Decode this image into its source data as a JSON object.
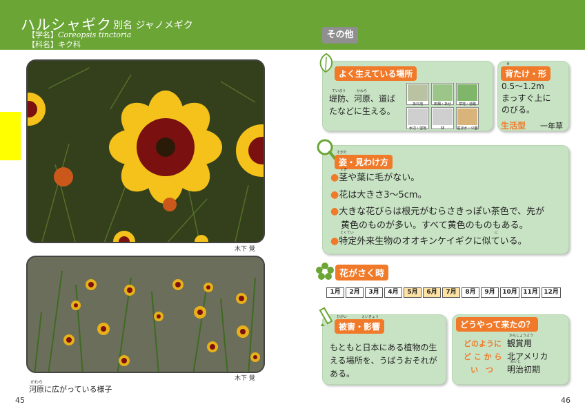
{
  "header": {
    "name": "ハルシャギク",
    "alias_label": "別名",
    "alias": "ジャノメギク",
    "scientific_label": "【学名】",
    "scientific": "Coreopsis tinctoria",
    "family_label": "【科名】",
    "family": "キク科",
    "section_tag": "その他"
  },
  "photos": {
    "credit_1": "木下 覺",
    "credit_2": "木下 覺",
    "caption_ruby": "かわら",
    "caption": "河原に広がっている様子"
  },
  "pages": {
    "left": "45",
    "right": "46"
  },
  "habitat": {
    "title": "よく生えている場所",
    "ruby_1": "ていぼう",
    "ruby_2": "かわら",
    "line_1": "堤防、河原、道ば",
    "line_2": "たなどに生える。",
    "icons": [
      {
        "name": "あれ地",
        "active": true
      },
      {
        "name": "田畑・あぜ",
        "active": true
      },
      {
        "name": "草地・道路",
        "active": true
      },
      {
        "name": "水辺・湿地",
        "active": false
      },
      {
        "name": "林",
        "active": false
      },
      {
        "name": "庭ほか・公園",
        "active": true
      }
    ]
  },
  "height": {
    "title_ruby": "せ",
    "title": "背たけ・形",
    "line_1": "0.5〜1.2m",
    "line_2": "まっすぐ上に",
    "line_3": "のびる。",
    "life_label": "生活型",
    "life_value": "一年草"
  },
  "shape": {
    "title_ruby": "すがた",
    "title": "姿・見わけ方",
    "items": [
      {
        "ruby": "くき",
        "line_1": "茎や葉に毛がない。",
        "line_2": ""
      },
      {
        "ruby": "",
        "line_1": "花は大きさ3〜5cm。",
        "line_2": ""
      },
      {
        "ruby": "",
        "line_1": "大きな花びらは根元がむらさきっぽい茶色で、先が",
        "line_2": "黄色のものが多い。すべて黄色のものもある。"
      },
      {
        "ruby": "とくてい",
        "line_1": "特定外来生物のオオキンケイギクに似ている。",
        "line_2": ""
      }
    ],
    "ruby_ni": "に"
  },
  "bloom": {
    "title": "花がさく時",
    "months": [
      {
        "label": "1月",
        "active": false
      },
      {
        "label": "2月",
        "active": false
      },
      {
        "label": "3月",
        "active": false
      },
      {
        "label": "4月",
        "active": false
      },
      {
        "label": "5月",
        "active": true
      },
      {
        "label": "6月",
        "active": true
      },
      {
        "label": "7月",
        "active": true
      },
      {
        "label": "8月",
        "active": false
      },
      {
        "label": "9月",
        "active": false
      },
      {
        "label": "10月",
        "active": false
      },
      {
        "label": "11月",
        "active": false
      },
      {
        "label": "12月",
        "active": false
      }
    ]
  },
  "impact": {
    "title_ruby_1": "ひがい",
    "title_ruby_2": "えいきょう",
    "title": "被害・影響",
    "line_1": "もともと日本にある植物の生",
    "line_2": "える場所を、うばうおそれが",
    "line_3": "ある。"
  },
  "origin": {
    "title": "どうやって来たの？",
    "rows": [
      {
        "label": "どのように",
        "ruby": "かんしょうよう",
        "value": "観賞用"
      },
      {
        "label": "ど こ か ら",
        "ruby": "",
        "value": "北アメリカ"
      },
      {
        "label": "い　つ",
        "ruby": "めいじ",
        "value": "明治初期"
      }
    ]
  },
  "colors": {
    "header_green": "#6aa535",
    "box_green": "#c8e3c4",
    "accent_orange": "#f07a2a",
    "tab_yellow": "#ffff00",
    "month_highlight": "#ffe3a3"
  }
}
